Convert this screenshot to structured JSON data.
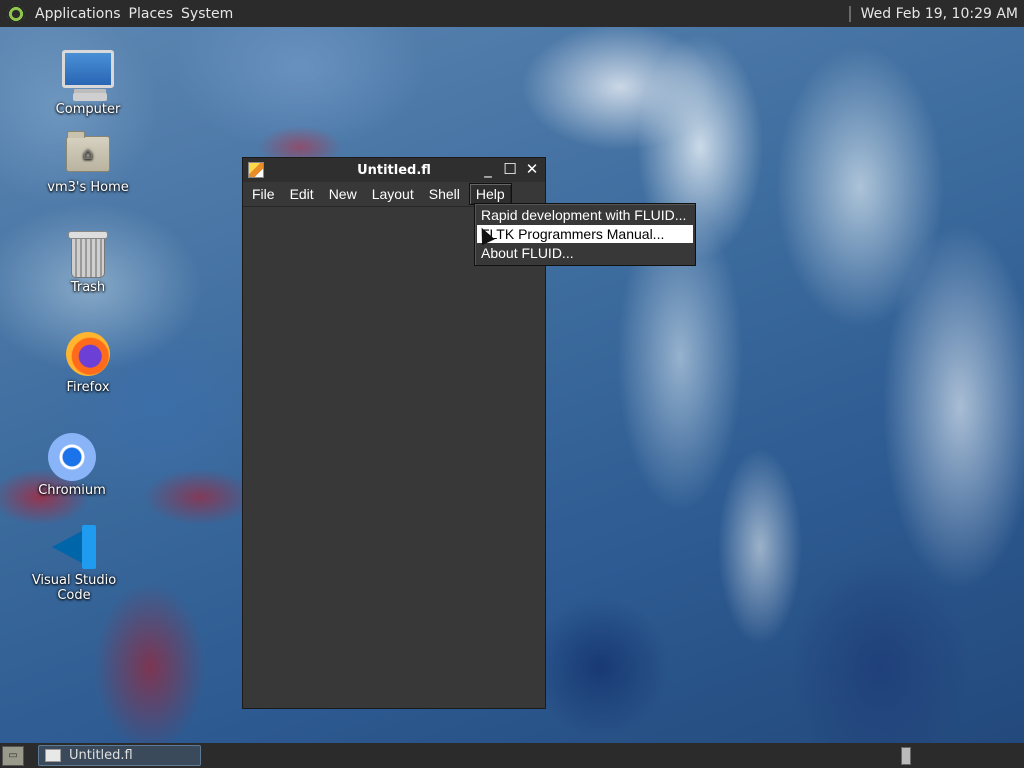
{
  "top_panel": {
    "menus": [
      "Applications",
      "Places",
      "System"
    ],
    "clock": "Wed Feb 19, 10:29 AM"
  },
  "desktop_icons": [
    {
      "label": "Computer",
      "icon": "computer-icon"
    },
    {
      "label": "vm3's Home",
      "icon": "home-folder-icon"
    },
    {
      "label": "Trash",
      "icon": "trash-icon"
    },
    {
      "label": "Firefox",
      "icon": "firefox-icon"
    },
    {
      "label": "Chromium",
      "icon": "chromium-icon"
    },
    {
      "label": "Visual Studio Code",
      "icon": "vscode-icon"
    }
  ],
  "window": {
    "title": "Untitled.fl",
    "controls": {
      "minimize": "_",
      "maximize": "☐",
      "close": "✕"
    },
    "menubar": [
      "File",
      "Edit",
      "New",
      "Layout",
      "Shell",
      "Help"
    ],
    "active_menu": "Help"
  },
  "help_menu": {
    "items": [
      {
        "label": "Rapid development with FLUID..."
      },
      {
        "label": "FLTK Programmers Manual...",
        "selected": true
      },
      {
        "label": "About FLUID..."
      }
    ]
  },
  "taskbar": {
    "tasks": [
      {
        "label": "Untitled.fl",
        "icon": "window-icon"
      }
    ]
  },
  "colors": {
    "panel": "#2b2b2b",
    "window_bg": "#383838",
    "menu_highlight": "#ffffff"
  }
}
